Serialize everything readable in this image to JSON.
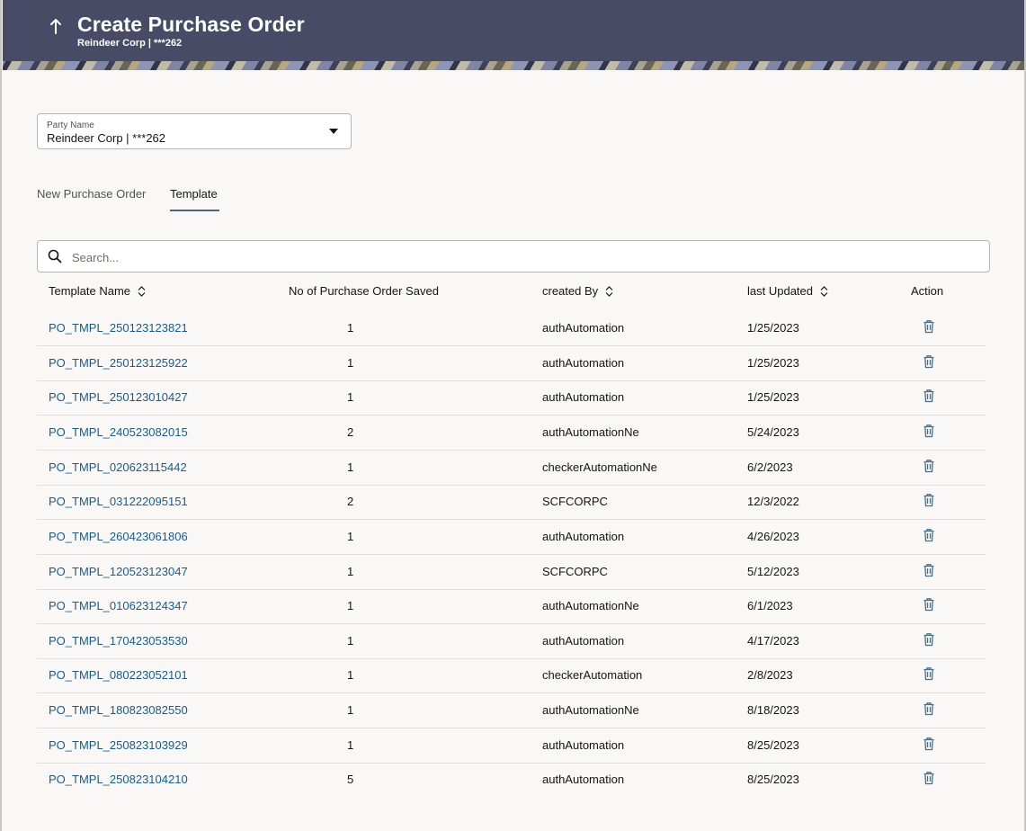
{
  "header": {
    "title": "Create Purchase Order",
    "subtitle": "Reindeer Corp | ***262"
  },
  "party": {
    "label": "Party Name",
    "value": "Reindeer Corp | ***262"
  },
  "tabs": [
    {
      "label": "New Purchase Order",
      "active": false
    },
    {
      "label": "Template",
      "active": true
    }
  ],
  "search": {
    "placeholder": "Search..."
  },
  "table": {
    "columns": [
      "Template Name",
      "No of Purchase Order Saved",
      "created By",
      "last Updated",
      "Action"
    ],
    "rows": [
      {
        "name": "PO_TMPL_250123123821",
        "count": "1",
        "created_by": "authAutomation",
        "updated": "1/25/2023"
      },
      {
        "name": "PO_TMPL_250123125922",
        "count": "1",
        "created_by": "authAutomation",
        "updated": "1/25/2023"
      },
      {
        "name": "PO_TMPL_250123010427",
        "count": "1",
        "created_by": "authAutomation",
        "updated": "1/25/2023"
      },
      {
        "name": "PO_TMPL_240523082015",
        "count": "2",
        "created_by": "authAutomationNe",
        "updated": "5/24/2023"
      },
      {
        "name": "PO_TMPL_020623115442",
        "count": "1",
        "created_by": "checkerAutomationNe",
        "updated": "6/2/2023"
      },
      {
        "name": "PO_TMPL_031222095151",
        "count": "2",
        "created_by": "SCFCORPC",
        "updated": "12/3/2022"
      },
      {
        "name": "PO_TMPL_260423061806",
        "count": "1",
        "created_by": "authAutomation",
        "updated": "4/26/2023"
      },
      {
        "name": "PO_TMPL_120523123047",
        "count": "1",
        "created_by": "SCFCORPC",
        "updated": "5/12/2023"
      },
      {
        "name": "PO_TMPL_010623124347",
        "count": "1",
        "created_by": "authAutomationNe",
        "updated": "6/1/2023"
      },
      {
        "name": "PO_TMPL_170423053530",
        "count": "1",
        "created_by": "authAutomation",
        "updated": "4/17/2023"
      },
      {
        "name": "PO_TMPL_080223052101",
        "count": "1",
        "created_by": "checkerAutomation",
        "updated": "2/8/2023"
      },
      {
        "name": "PO_TMPL_180823082550",
        "count": "1",
        "created_by": "authAutomationNe",
        "updated": "8/18/2023"
      },
      {
        "name": "PO_TMPL_250823103929",
        "count": "1",
        "created_by": "authAutomation",
        "updated": "8/25/2023"
      },
      {
        "name": "PO_TMPL_250823104210",
        "count": "5",
        "created_by": "authAutomation",
        "updated": "8/25/2023"
      }
    ]
  },
  "icons": {
    "back": "arrow-up-icon",
    "dropdown": "caret-down-icon",
    "search": "search-icon",
    "sort": "sort-icon",
    "delete": "trash-icon"
  },
  "colors": {
    "header_bg": "#474b65",
    "link": "#1b5b84",
    "tab_underline": "#53627a",
    "delete_icon": "#4a6d88"
  }
}
